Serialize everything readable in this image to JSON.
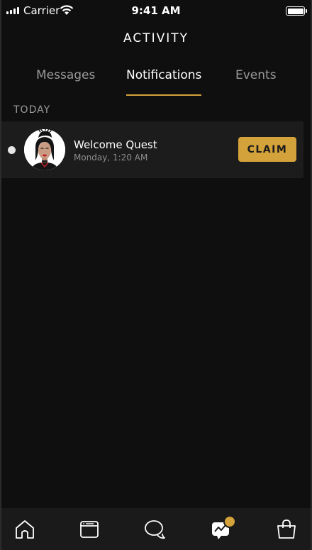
{
  "status_bar": {
    "carrier": "Carrier",
    "time": "9:41 AM"
  },
  "header": {
    "title": "ACTIVITY"
  },
  "tabs": [
    {
      "label": "Messages",
      "active": false
    },
    {
      "label": "Notifications",
      "active": true
    },
    {
      "label": "Events",
      "active": false
    }
  ],
  "section": {
    "label": "TODAY"
  },
  "notifications": [
    {
      "title": "Welcome Quest",
      "time": "Monday, 1:20 AM",
      "action_label": "CLAIM",
      "unread": true
    }
  ],
  "bottom_nav": [
    {
      "icon": "home-icon"
    },
    {
      "icon": "feed-icon"
    },
    {
      "icon": "chat-icon"
    },
    {
      "icon": "activity-icon",
      "badge": true,
      "active": true
    },
    {
      "icon": "shop-icon"
    }
  ],
  "colors": {
    "accent": "#d4a23a",
    "background": "#0f0f0f",
    "row_background": "#1c1c1c"
  }
}
